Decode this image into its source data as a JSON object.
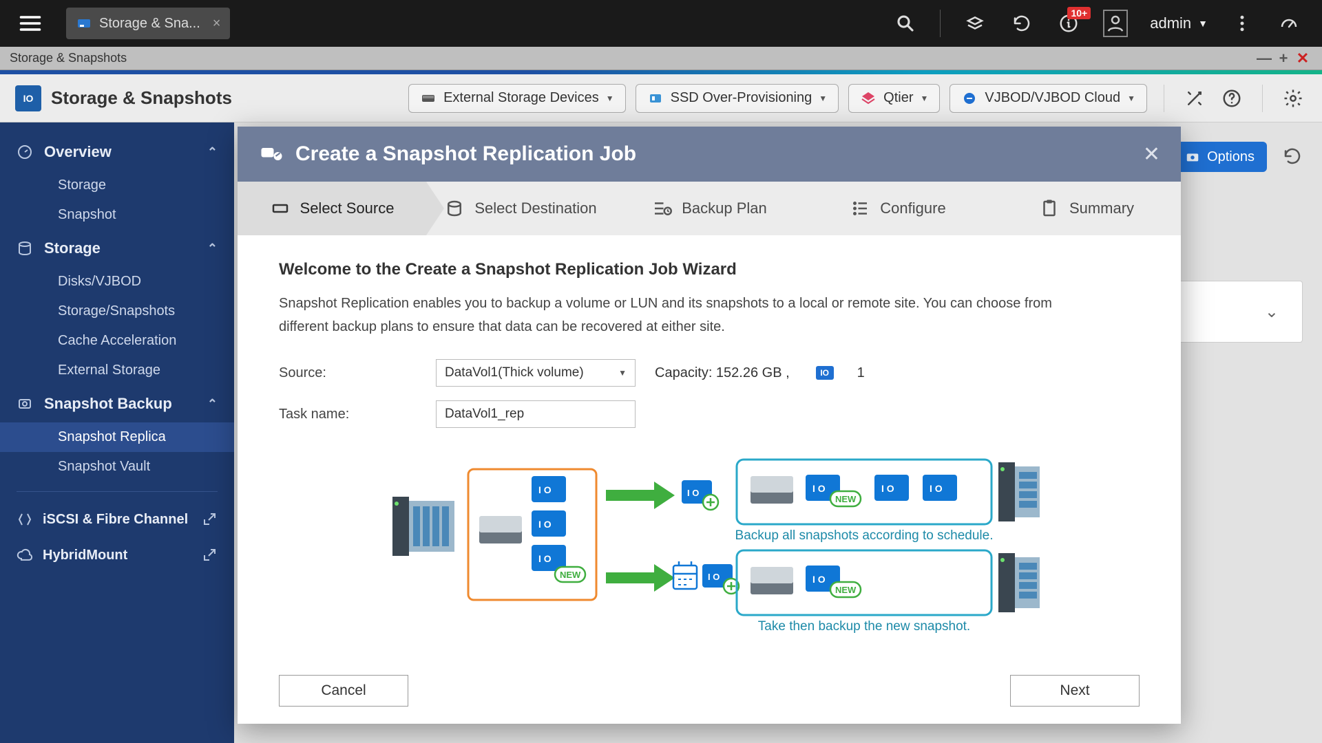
{
  "topbar": {
    "tab_label": "Storage & Sna...",
    "notif_badge": "10+",
    "user_label": "admin"
  },
  "window": {
    "title": "Storage & Snapshots"
  },
  "app_toolbar": {
    "title": "Storage & Snapshots",
    "buttons": {
      "external_storage": "External Storage Devices",
      "ssd_over": "SSD Over-Provisioning",
      "qtier": "Qtier",
      "vjbod": "VJBOD/VJBOD Cloud"
    }
  },
  "sidebar": {
    "overview": {
      "label": "Overview",
      "items": [
        "Storage",
        "Snapshot"
      ]
    },
    "storage": {
      "label": "Storage",
      "items": [
        "Disks/VJBOD",
        "Storage/Snapshots",
        "Cache Acceleration",
        "External Storage"
      ]
    },
    "snapshot_backup": {
      "label": "Snapshot Backup",
      "items": [
        "Snapshot Replica",
        "Snapshot Vault"
      ]
    },
    "links": {
      "iscsi": "iSCSI & Fibre Channel",
      "hybrid": "HybridMount"
    }
  },
  "main": {
    "options_label": "Options"
  },
  "modal": {
    "title": "Create a Snapshot Replication Job",
    "steps": [
      "Select Source",
      "Select Destination",
      "Backup Plan",
      "Configure",
      "Summary"
    ],
    "welcome_title": "Welcome to the Create a Snapshot Replication Job Wizard",
    "welcome_desc": "Snapshot Replication enables you to backup a volume or LUN and its snapshots to a local or remote site. You can choose from different backup plans to ensure that data can be recovered at either site.",
    "source_label": "Source:",
    "source_value": "DataVol1(Thick volume)",
    "capacity_label": "Capacity: 152.26 GB ,",
    "snap_count": "1",
    "taskname_label": "Task name:",
    "taskname_value": "DataVol1_rep",
    "illus_caption1": "Backup all snapshots according to schedule.",
    "illus_caption2": "Take then backup the new snapshot.",
    "illus_new_badge": "NEW",
    "cancel": "Cancel",
    "next": "Next"
  }
}
